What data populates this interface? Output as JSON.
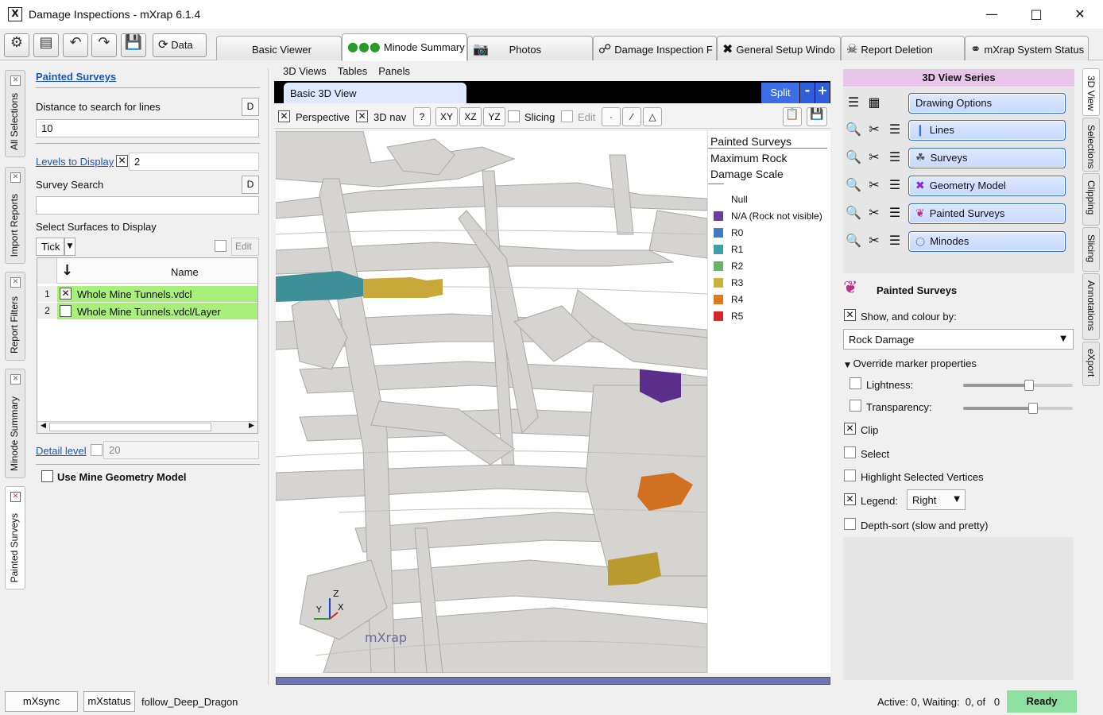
{
  "window": {
    "title": "Damage Inspections - mXrap 6.1.4"
  },
  "toolbar": {
    "data_label": "Data"
  },
  "tabs": [
    {
      "label": "Basic Viewer"
    },
    {
      "label": "Minode Summary"
    },
    {
      "label": "Photos"
    },
    {
      "label": "Damage Inspection F"
    },
    {
      "label": "General Setup Windo"
    },
    {
      "label": "Report Deletion"
    },
    {
      "label": "mXrap System Status"
    }
  ],
  "left_tabs": [
    "All Selections",
    "Import Reports",
    "Report Filters",
    "Minode Summary",
    "Painted Surveys"
  ],
  "left_panel": {
    "title_link": "Painted Surveys",
    "distance_label": "Distance to search for lines",
    "distance_value": "10",
    "d_label": "D",
    "levels_link": "Levels to Display",
    "levels_value": "2",
    "survey_search_label": "Survey Search",
    "survey_search_value": "",
    "select_surfaces_label": "Select Surfaces to Display",
    "tick_label": "Tick",
    "edit_label": "Edit",
    "table_header_name": "Name",
    "rows": [
      {
        "num": "1",
        "name": "Whole Mine Tunnels.vdcl",
        "checked": true
      },
      {
        "num": "2",
        "name": "Whole Mine Tunnels.vdcl/Layer",
        "checked": false
      }
    ],
    "detail_link": "Detail level",
    "detail_value": "20",
    "use_geometry_label": "Use Mine Geometry Model"
  },
  "viewer": {
    "menus": [
      "3D Views",
      "Tables",
      "Panels"
    ],
    "tab_label": "Basic 3D View",
    "split_label": "Split",
    "minus_label": "-",
    "plus_label": "+",
    "perspective_label": "Perspective",
    "nav_label": "3D nav",
    "help_label": "?",
    "xy_label": "XY",
    "xz_label": "XZ",
    "yz_label": "YZ",
    "slicing_label": "Slicing",
    "edit_label": "Edit",
    "watermark": "mXrap",
    "axis_z": "Z",
    "axis_y": "Y",
    "axis_x": "X",
    "legend": {
      "title": "Painted Surveys",
      "subtitle1": "Maximum Rock",
      "subtitle2": "Damage Scale",
      "items": [
        {
          "label": "Null",
          "color": "#ffffff"
        },
        {
          "label": "N/A (Rock not visible)",
          "color": "#6a3f9a"
        },
        {
          "label": "R0",
          "color": "#3f7fc0"
        },
        {
          "label": "R1",
          "color": "#3f9fa8"
        },
        {
          "label": "R2",
          "color": "#6ab36a"
        },
        {
          "label": "R3",
          "color": "#c9b23a"
        },
        {
          "label": "R4",
          "color": "#e07820"
        },
        {
          "label": "R5",
          "color": "#d8262a"
        }
      ]
    }
  },
  "right_panel": {
    "series_header": "3D View Series",
    "drawing_options": "Drawing Options",
    "series": [
      {
        "label": "Lines"
      },
      {
        "label": "Surveys"
      },
      {
        "label": "Geometry Model"
      },
      {
        "label": "Painted Surveys"
      },
      {
        "label": "Minodes"
      }
    ],
    "section_title": "Painted Surveys",
    "show_colour_label": "Show, and colour by:",
    "colour_by_value": "Rock Damage",
    "override_label": "Override marker properties",
    "lightness_label": "Lightness:",
    "lightness_value": 0.6,
    "transparency_label": "Transparency:",
    "transparency_value": 0.64,
    "clip_label": "Clip",
    "select_label": "Select",
    "highlight_label": "Highlight Selected Vertices",
    "legend_label": "Legend:",
    "legend_value": "Right",
    "depth_sort_label": "Depth-sort (slow and pretty)"
  },
  "right_tabs": [
    "3D View",
    "Selections",
    "Clipping",
    "Slicing",
    "Annotations",
    "eXport"
  ],
  "status": {
    "mxsync": "mXsync",
    "mxstatus": "mXstatus",
    "user": "follow_Deep_Dragon",
    "activity": "Active: 0, Waiting:  0, of   0",
    "ready": "Ready"
  }
}
